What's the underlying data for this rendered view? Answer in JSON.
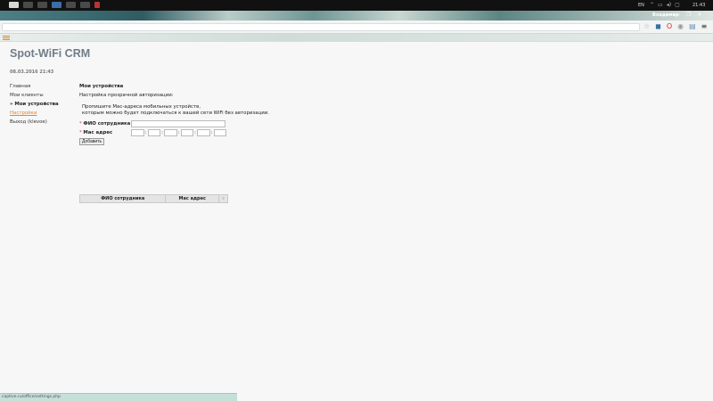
{
  "taskbar": {
    "lang": "EN",
    "clock": "21:43"
  },
  "browser": {
    "user": "Владимир",
    "address": ""
  },
  "app": {
    "title": "Spot-WiFi CRM",
    "datetime": "08.03.2016 21:43"
  },
  "nav": {
    "items": [
      "Главная",
      "Мои клиенты",
      "» Мои устройства",
      "Настройки",
      "Выход (klevoe)"
    ]
  },
  "main": {
    "heading": "Мои устройства",
    "subheading": "Настройка прозрачной авторизации:",
    "description_line1": "Пропишите Mac-адреса мобильных устройств,",
    "description_line2": "которым можно будет подключаться к вашей сети WiFi без авторизации."
  },
  "form": {
    "required_mark": "*",
    "name_label": "ФИО сотрудника",
    "name_value": "",
    "mac_label": "Mac адрес",
    "mac_separator": ":",
    "mac_segments": [
      "",
      "",
      "",
      "",
      "",
      ""
    ],
    "add_button": "Добавить"
  },
  "table": {
    "col_name": "ФИО сотрудника",
    "col_mac": "Mac адрес",
    "sort_indicator": "▿"
  },
  "status_bar": {
    "url": "captive.ru/office/settings.php"
  }
}
